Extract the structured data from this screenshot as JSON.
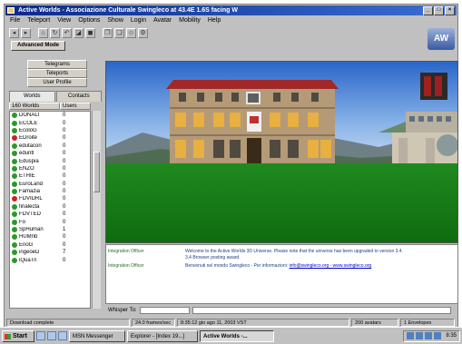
{
  "window": {
    "title": "Active Worlds - Associazione Culturale Swingleco at 43.4E 1.6S facing W"
  },
  "menu": [
    "File",
    "Teleport",
    "View",
    "Options",
    "Show",
    "Login",
    "Avatar",
    "Mobility",
    "Help"
  ],
  "advanced_tab": "Advanced Mode",
  "nav": {
    "telegrams": "Telegrams",
    "teleports": "Teleports",
    "user_profile": "User Profile"
  },
  "tabs": {
    "worlds": "Worlds",
    "contacts": "Contacts"
  },
  "list_headers": {
    "name": "160 Worlds",
    "users": "Users"
  },
  "worlds": [
    {
      "name": "DONALI",
      "users": "0",
      "status": "green"
    },
    {
      "name": "ECOLE",
      "users": "0",
      "status": "green"
    },
    {
      "name": "EcoloG",
      "users": "0",
      "status": "green"
    },
    {
      "name": "EDroite",
      "users": "0",
      "status": "red"
    },
    {
      "name": "edutacon",
      "users": "0",
      "status": "green"
    },
    {
      "name": "eduntl",
      "users": "0",
      "status": "green"
    },
    {
      "name": "Eduspia",
      "users": "0",
      "status": "green"
    },
    {
      "name": "ENZO",
      "users": "0",
      "status": "green"
    },
    {
      "name": "ETHIE",
      "users": "0",
      "status": "green"
    },
    {
      "name": "EuroLand",
      "users": "0",
      "status": "green"
    },
    {
      "name": "Famazia",
      "users": "0",
      "status": "green"
    },
    {
      "name": "FDVIDRL",
      "users": "0",
      "status": "red"
    },
    {
      "name": "finalecta",
      "users": "0",
      "status": "green"
    },
    {
      "name": "FDVTED",
      "users": "0",
      "status": "green"
    },
    {
      "name": "Fo",
      "users": "0",
      "status": "green"
    },
    {
      "name": "SpHuman",
      "users": "1",
      "status": "green"
    },
    {
      "name": "HUMnb",
      "users": "0",
      "status": "green"
    },
    {
      "name": "EnoG",
      "users": "0",
      "status": "green"
    },
    {
      "name": "ingeoeD",
      "users": "7",
      "status": "green"
    },
    {
      "name": "iQuaTri",
      "users": "0",
      "status": "green"
    }
  ],
  "chat": [
    {
      "name": "Integration Officer",
      "message": "Welcome to the Active Worlds 3D Universe. Please note that the universe has been upgraded to version 3.4.",
      "link": ""
    },
    {
      "name": "",
      "message": "3.4 Browser posting award.",
      "link": ""
    },
    {
      "name": "Integration Officer",
      "message": "Benvenuti nel mondo Swingleco - Per informazioni:",
      "link": "info@swingleco.org - www.swingleco.org"
    }
  ],
  "whisper": {
    "label": "Whisper To:"
  },
  "status": {
    "left": "Download complete",
    "fps": "24.0 frames/sec",
    "time": "8:35:12 gio ago 11, 2003 VST",
    "users": "200 avatars",
    "objects": "1 Envelopes"
  },
  "taskbar": {
    "start": "Start",
    "tasks": [
      "MSN Messenger",
      "Explorer - [Index 19...]",
      "Active Worlds -..."
    ],
    "clock": "8:35"
  },
  "logo": {
    "text": "AW"
  }
}
